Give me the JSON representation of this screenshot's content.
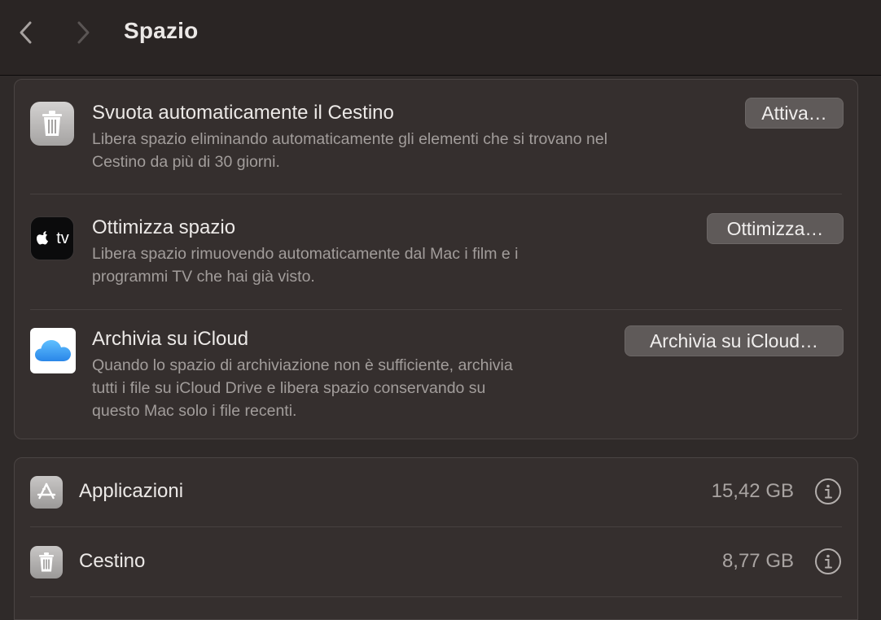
{
  "header": {
    "title": "Spazio",
    "back_icon": "chevron-left-icon",
    "forward_icon": "chevron-right-icon"
  },
  "recommendations": [
    {
      "icon": "trash-icon",
      "title": "Svuota automaticamente il Cestino",
      "description_lines": [
        "Libera spazio eliminando automaticamente gli elementi che si trovano nel",
        "Cestino da più di 30 giorni."
      ],
      "button_label": "Attiva…"
    },
    {
      "icon": "apple-tv-icon",
      "icon_text": "tv",
      "title": "Ottimizza spazio",
      "description_lines": [
        "Libera spazio rimuovendo automaticamente dal Mac i film e i",
        "programmi TV che hai già visto."
      ],
      "button_label": "Ottimizza…"
    },
    {
      "icon": "icloud-icon",
      "title": "Archivia su iCloud",
      "description_lines": [
        "Quando lo spazio di archiviazione non è sufficiente, archivia",
        "tutti i file su iCloud Drive e libera spazio conservando su",
        "questo Mac solo i file recenti."
      ],
      "button_label": "Archivia su iCloud…"
    }
  ],
  "storage": [
    {
      "icon": "app-store-icon",
      "label": "Applicazioni",
      "size": "15,42 GB"
    },
    {
      "icon": "trash-icon",
      "label": "Cestino",
      "size": "8,77 GB"
    }
  ],
  "colors": {
    "background": "#2f2a29",
    "card": "#352f2e",
    "button": "#5f5a59",
    "icloud_blue": "#3a9bf0"
  }
}
